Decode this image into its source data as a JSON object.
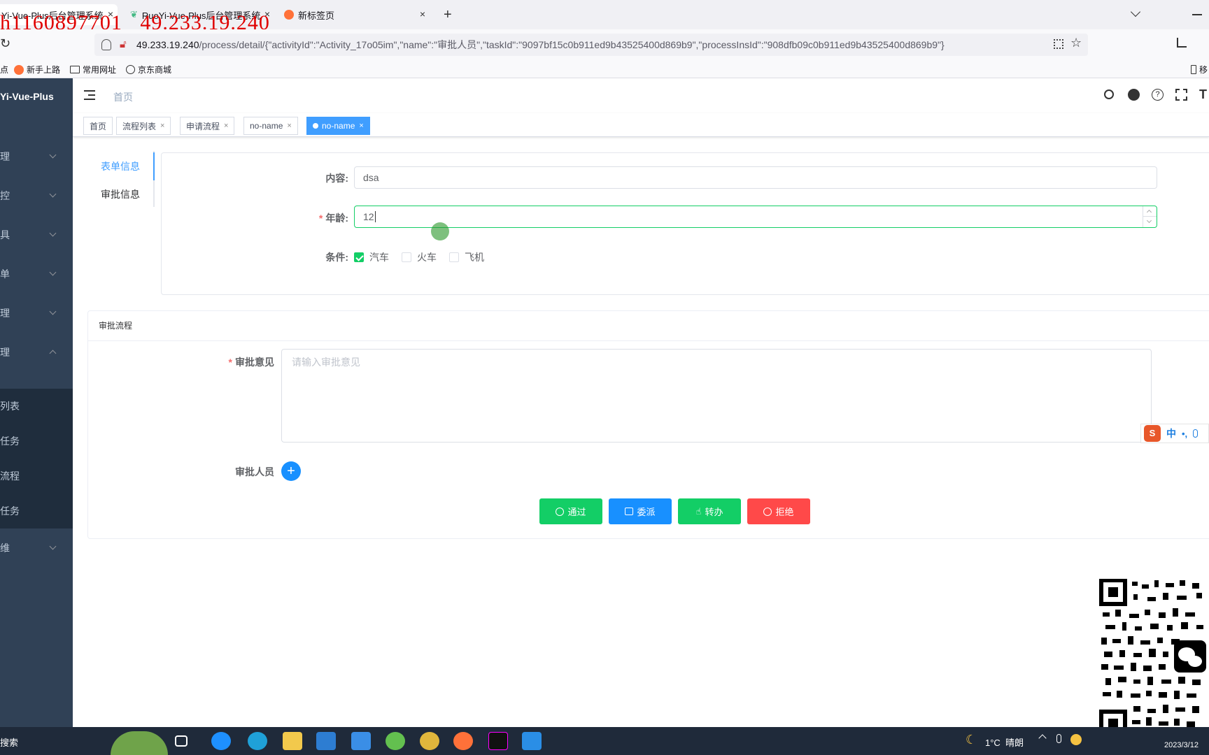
{
  "browser": {
    "tabs": [
      {
        "label": "Yi-Vue-Plus后台管理系统"
      },
      {
        "label": "RuoYi-Vue-Plus后台管理系统"
      },
      {
        "label": "新标签页"
      }
    ],
    "close_glyph": "×",
    "new_tab_glyph": "+",
    "url_host": "49.233.19.240",
    "url_path": "/process/detail/{\"activityId\":\"Activity_17o05im\",\"name\":\"审批人员\",\"taskId\":\"9097bf15c0b911ed9b43525400d869b9\",\"processInsId\":\"908dfb09c0b911ed9b43525400d869b9\"}",
    "bookmarks": [
      "点",
      "新手上路",
      "常用网址",
      "京东商城"
    ],
    "bookmarks_right": "移",
    "watermark": "h1160897701   49.233.19.240"
  },
  "sidebar": {
    "logo": "Yi-Vue-Plus",
    "menus": [
      "理",
      "控",
      "具",
      "单",
      "理",
      "理",
      "维"
    ],
    "submenu": [
      "列表",
      "任务",
      "流程",
      "任务"
    ]
  },
  "header": {
    "breadcrumb": "首页"
  },
  "tagsview": {
    "tags": [
      "首页",
      "流程列表",
      "申请流程",
      "no-name",
      "no-name"
    ],
    "close_glyph": "×"
  },
  "form_tabs": [
    "表单信息",
    "审批信息"
  ],
  "form": {
    "content_label": "内容:",
    "content_value": "dsa",
    "age_label": "年龄:",
    "age_value": "12",
    "condition_label": "条件:",
    "options": [
      {
        "label": "汽车",
        "checked": true
      },
      {
        "label": "火车",
        "checked": false
      },
      {
        "label": "飞机",
        "checked": false
      }
    ]
  },
  "approval": {
    "title": "审批流程",
    "opinion_label": "审批意见",
    "opinion_placeholder": "请输入审批意见",
    "approver_label": "审批人员",
    "add_glyph": "+",
    "buttons": [
      {
        "label": "通过",
        "color": "#13ce66"
      },
      {
        "label": "委派",
        "color": "#1890ff"
      },
      {
        "label": "转办",
        "color": "#13ce66"
      },
      {
        "label": "拒绝",
        "color": "#ff4949"
      }
    ]
  },
  "ime": {
    "mode": "中",
    "punct": "•,"
  },
  "taskbar": {
    "search": "搜索",
    "weather": "1°C  晴朗",
    "date": "2023/3/12"
  }
}
